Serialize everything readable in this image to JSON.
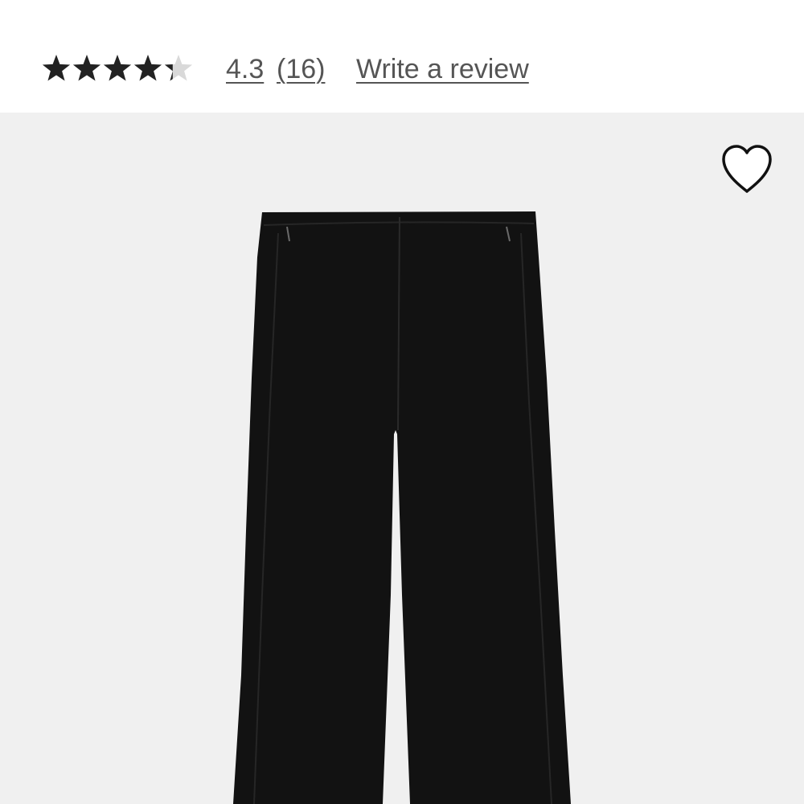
{
  "rating": {
    "value": "4.3",
    "stars_filled": 4.3,
    "stars_total": 5,
    "count": "(16)",
    "write_review": "Write a review"
  },
  "product": {
    "image_subject": "black flare pants"
  },
  "icons": {
    "star": "star-icon",
    "wishlist": "heart-icon"
  },
  "colors": {
    "star_filled": "#222222",
    "star_empty": "#d9d9d9",
    "link": "#555555",
    "image_bg": "#f0f0f0",
    "product": "#121212"
  }
}
